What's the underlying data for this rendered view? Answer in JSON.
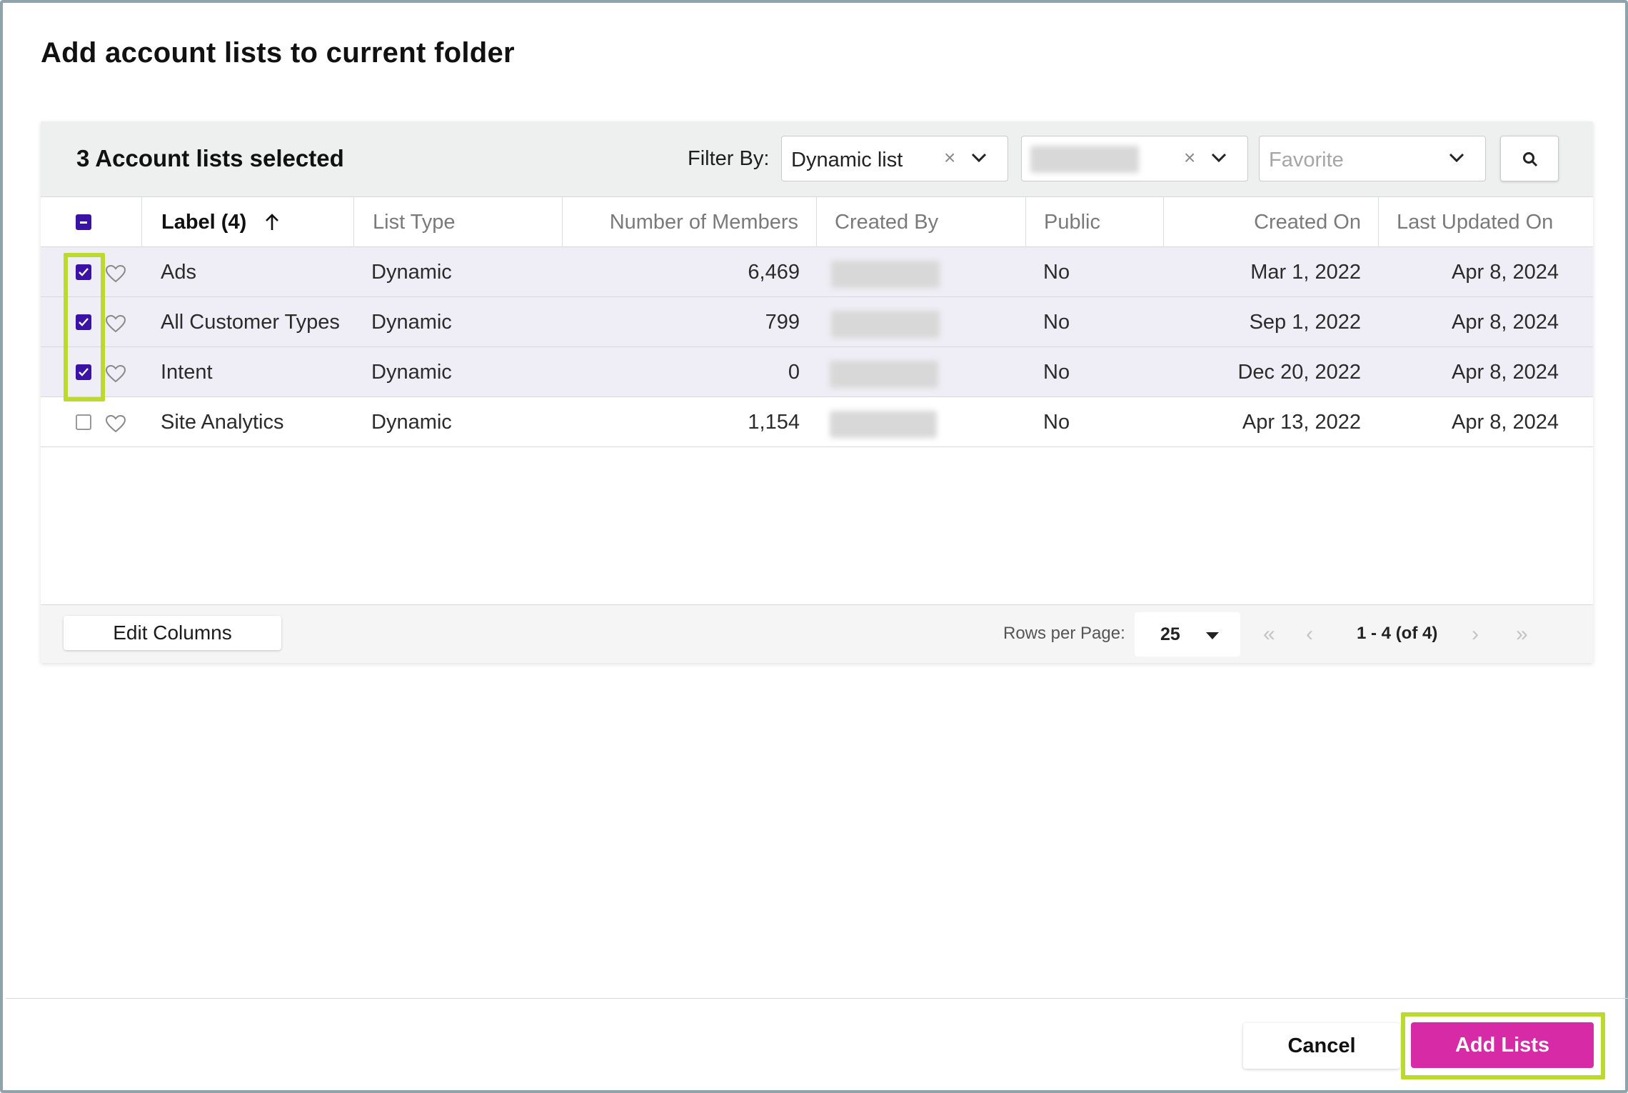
{
  "dialog": {
    "title": "Add account lists to current folder"
  },
  "toolbar": {
    "selected_count": "3 Account lists selected",
    "filter_label": "Filter By:",
    "filter_type": {
      "value": "Dynamic list",
      "clear": "×"
    },
    "filter_owner": {
      "clear": "×"
    },
    "filter_favorite": {
      "placeholder": "Favorite"
    }
  },
  "columns": {
    "label": "Label (4)",
    "list_type": "List Type",
    "members": "Number of Members",
    "created_by": "Created By",
    "public": "Public",
    "created_on": "Created On",
    "last_updated": "Last Updated On"
  },
  "rows": [
    {
      "label": "Ads",
      "type": "Dynamic",
      "members": "6,469",
      "public": "No",
      "created_on": "Mar 1, 2022",
      "updated_on": "Apr 8, 2024",
      "checked": true
    },
    {
      "label": "All Customer Types",
      "type": "Dynamic",
      "members": "799",
      "public": "No",
      "created_on": "Sep 1, 2022",
      "updated_on": "Apr 8, 2024",
      "checked": true
    },
    {
      "label": "Intent",
      "type": "Dynamic",
      "members": "0",
      "public": "No",
      "created_on": "Dec 20, 2022",
      "updated_on": "Apr 8, 2024",
      "checked": true
    },
    {
      "label": "Site Analytics",
      "type": "Dynamic",
      "members": "1,154",
      "public": "No",
      "created_on": "Apr 13, 2022",
      "updated_on": "Apr 8, 2024",
      "checked": false
    }
  ],
  "footer": {
    "edit_columns": "Edit Columns",
    "rows_per_page_label": "Rows per Page:",
    "rows_per_page": "25",
    "page_info": "1 - 4 (of 4)",
    "first": "«",
    "prev": "‹",
    "next": "›",
    "last": "»"
  },
  "actions": {
    "cancel": "Cancel",
    "add": "Add Lists"
  },
  "colors": {
    "accent": "#3a12a6",
    "primary_button": "#d62aa6",
    "highlight": "#bcd92e",
    "selected_row": "#efeef6"
  }
}
